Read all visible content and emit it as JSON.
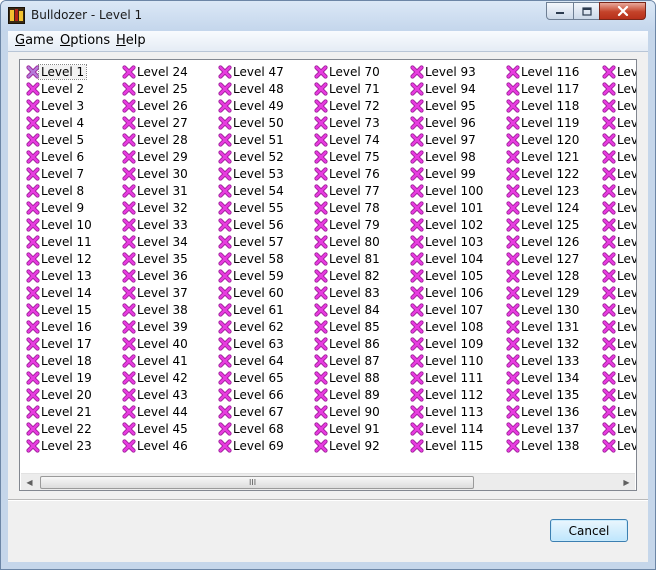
{
  "window": {
    "title": "Bulldozer - Level 1"
  },
  "menu": {
    "game": {
      "first": "G",
      "rest": "ame"
    },
    "options": {
      "first": "O",
      "rest": "ptions"
    },
    "help": {
      "first": "H",
      "rest": "elp"
    }
  },
  "levels": {
    "selected": "Level 1",
    "icon": "x-mark-icon",
    "icon_color": "#e83ce0",
    "columns": [
      [
        "Level 1",
        "Level 2",
        "Level 3",
        "Level 4",
        "Level 5",
        "Level 6",
        "Level 7",
        "Level 8",
        "Level 9",
        "Level 10",
        "Level 11",
        "Level 12",
        "Level 13",
        "Level 14",
        "Level 15",
        "Level 16",
        "Level 17",
        "Level 18",
        "Level 19",
        "Level 20",
        "Level 21",
        "Level 22",
        "Level 23"
      ],
      [
        "Level 24",
        "Level 25",
        "Level 26",
        "Level 27",
        "Level 28",
        "Level 29",
        "Level 30",
        "Level 31",
        "Level 32",
        "Level 33",
        "Level 34",
        "Level 35",
        "Level 36",
        "Level 37",
        "Level 38",
        "Level 39",
        "Level 40",
        "Level 41",
        "Level 42",
        "Level 43",
        "Level 44",
        "Level 45",
        "Level 46"
      ],
      [
        "Level 47",
        "Level 48",
        "Level 49",
        "Level 50",
        "Level 51",
        "Level 52",
        "Level 53",
        "Level 54",
        "Level 55",
        "Level 56",
        "Level 57",
        "Level 58",
        "Level 59",
        "Level 60",
        "Level 61",
        "Level 62",
        "Level 63",
        "Level 64",
        "Level 65",
        "Level 66",
        "Level 67",
        "Level 68",
        "Level 69"
      ],
      [
        "Level 70",
        "Level 71",
        "Level 72",
        "Level 73",
        "Level 74",
        "Level 75",
        "Level 76",
        "Level 77",
        "Level 78",
        "Level 79",
        "Level 80",
        "Level 81",
        "Level 82",
        "Level 83",
        "Level 84",
        "Level 85",
        "Level 86",
        "Level 87",
        "Level 88",
        "Level 89",
        "Level 90",
        "Level 91",
        "Level 92"
      ],
      [
        "Level 93",
        "Level 94",
        "Level 95",
        "Level 96",
        "Level 97",
        "Level 98",
        "Level 99",
        "Level 100",
        "Level 101",
        "Level 102",
        "Level 103",
        "Level 104",
        "Level 105",
        "Level 106",
        "Level 107",
        "Level 108",
        "Level 109",
        "Level 110",
        "Level 111",
        "Level 112",
        "Level 113",
        "Level 114",
        "Level 115"
      ],
      [
        "Level 116",
        "Level 117",
        "Level 118",
        "Level 119",
        "Level 120",
        "Level 121",
        "Level 122",
        "Level 123",
        "Level 124",
        "Level 125",
        "Level 126",
        "Level 127",
        "Level 128",
        "Level 129",
        "Level 130",
        "Level 131",
        "Level 132",
        "Level 133",
        "Level 134",
        "Level 135",
        "Level 136",
        "Level 137",
        "Level 138"
      ],
      [
        "Leve",
        "Leve",
        "Leve",
        "Leve",
        "Leve",
        "Leve",
        "Leve",
        "Leve",
        "Leve",
        "Leve",
        "Leve",
        "Leve",
        "Leve",
        "Leve",
        "Leve",
        "Leve",
        "Leve",
        "Leve",
        "Leve",
        "Leve",
        "Leve",
        "Leve",
        "Leve"
      ]
    ]
  },
  "scrollbar": {
    "grip": "III"
  },
  "buttons": {
    "cancel": "Cancel"
  }
}
